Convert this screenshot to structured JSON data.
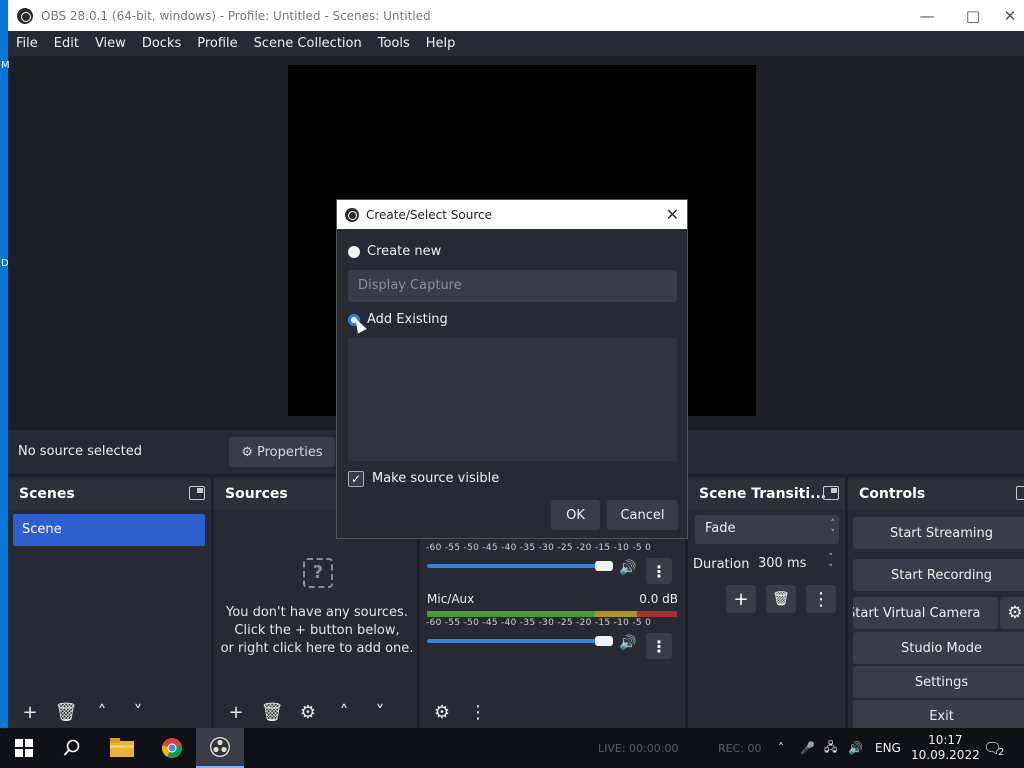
{
  "window": {
    "title": "OBS 28.0.1 (64-bit, windows) - Profile: Untitled - Scenes: Untitled"
  },
  "desktop_strip": {
    "letters": [
      "M",
      "D"
    ]
  },
  "menu": [
    "File",
    "Edit",
    "View",
    "Docks",
    "Profile",
    "Scene Collection",
    "Tools",
    "Help"
  ],
  "status": {
    "no_source": "No source selected",
    "properties_label": "Properties"
  },
  "scenes": {
    "title": "Scenes",
    "items": [
      "Scene"
    ]
  },
  "sources": {
    "title": "Sources",
    "empty_line1": "You don't have any sources.",
    "empty_line2": "Click the + button below,",
    "empty_line3": "or right click here to add one."
  },
  "mixer": {
    "scale": "-60 -55 -50 -45 -40 -35 -30 -25 -20 -15 -10 -5 0",
    "channels": [
      {
        "name": "",
        "db": "",
        "volume": 1.0
      },
      {
        "name": "Mic/Aux",
        "db": "0.0 dB",
        "volume": 1.0
      }
    ]
  },
  "transitions": {
    "title": "Scene Transiti...",
    "selected": "Fade",
    "duration_label": "Duration",
    "duration_value": "300 ms"
  },
  "controls": {
    "title": "Controls",
    "start_streaming": "Start Streaming",
    "start_recording": "Start Recording",
    "start_virtual_camera": "Start Virtual Camera",
    "studio_mode": "Studio Mode",
    "settings": "Settings",
    "exit": "Exit"
  },
  "dialog": {
    "title": "Create/Select Source",
    "create_new_label": "Create new",
    "create_new_placeholder": "Display Capture",
    "add_existing_label": "Add Existing",
    "make_visible_label": "Make source visible",
    "make_visible_checked": true,
    "ok_label": "OK",
    "cancel_label": "Cancel"
  },
  "taskbar": {
    "live": "LIVE: 00:00:00",
    "rec": "REC: 00",
    "language": "ENG",
    "time": "10:17",
    "date": "10.09.2022",
    "notifications": "2"
  },
  "colors": {
    "accent": "#2f5fcf",
    "dock_bg": "#272a33",
    "button_bg": "#3a3d47",
    "slider": "#3582d9"
  }
}
